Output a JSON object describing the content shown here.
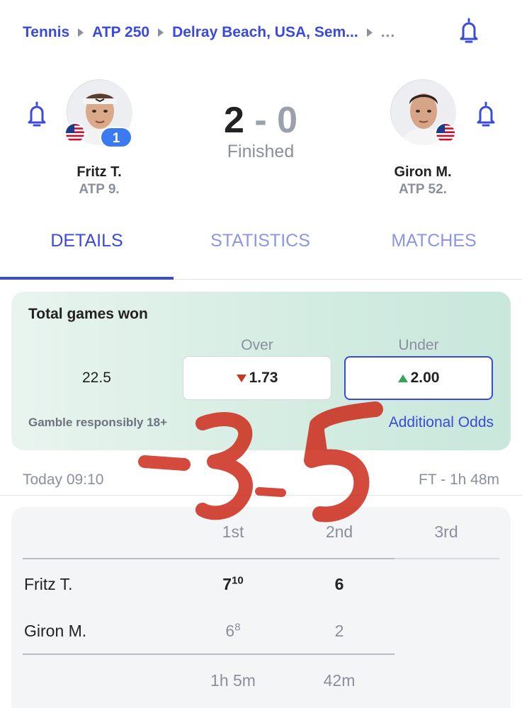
{
  "breadcrumb": {
    "items": [
      "Tennis",
      "ATP 250",
      "Delray Beach, USA, Sem..."
    ],
    "more": "..."
  },
  "icons": {
    "bell": "bell-icon",
    "flag": "usa-flag-icon",
    "chevron": "chevron-right-icon"
  },
  "match": {
    "home": {
      "name": "Fritz T.",
      "rank": "ATP 9.",
      "seed": "1"
    },
    "away": {
      "name": "Giron M.",
      "rank": "ATP 52."
    },
    "score_home": "2",
    "score_sep": "-",
    "score_away": "0",
    "status": "Finished"
  },
  "tabs": [
    {
      "label": "DETAILS",
      "active": true
    },
    {
      "label": "STATISTICS",
      "active": false
    },
    {
      "label": "MATCHES",
      "active": false
    }
  ],
  "odds": {
    "title": "Total games won",
    "line": "22.5",
    "over_label": "Over",
    "under_label": "Under",
    "over_value": "1.73",
    "under_value": "2.00",
    "over_trend": "down",
    "under_trend": "up",
    "disclaimer": "Gamble responsibly 18+",
    "more_link": "Additional Odds"
  },
  "time": {
    "start": "Today 09:10",
    "result": "FT - 1h 48m"
  },
  "sets": {
    "headers": [
      "1st",
      "2nd",
      "3rd"
    ],
    "home": {
      "name": "Fritz T.",
      "s1": "7",
      "s1_tb": "10",
      "s2": "6"
    },
    "away": {
      "name": "Giron M.",
      "s1": "6",
      "s1_tb": "8",
      "s2": "2"
    },
    "durations": [
      "1h 5m",
      "42m"
    ]
  },
  "annotation": {
    "text": "-3-5",
    "color": "#cc2a1a"
  },
  "colors": {
    "accent": "#3a4ad9",
    "badge": "#3a7bf0",
    "odds_bg": "#d3ece2",
    "down": "#c9371e",
    "up": "#38a35a"
  }
}
